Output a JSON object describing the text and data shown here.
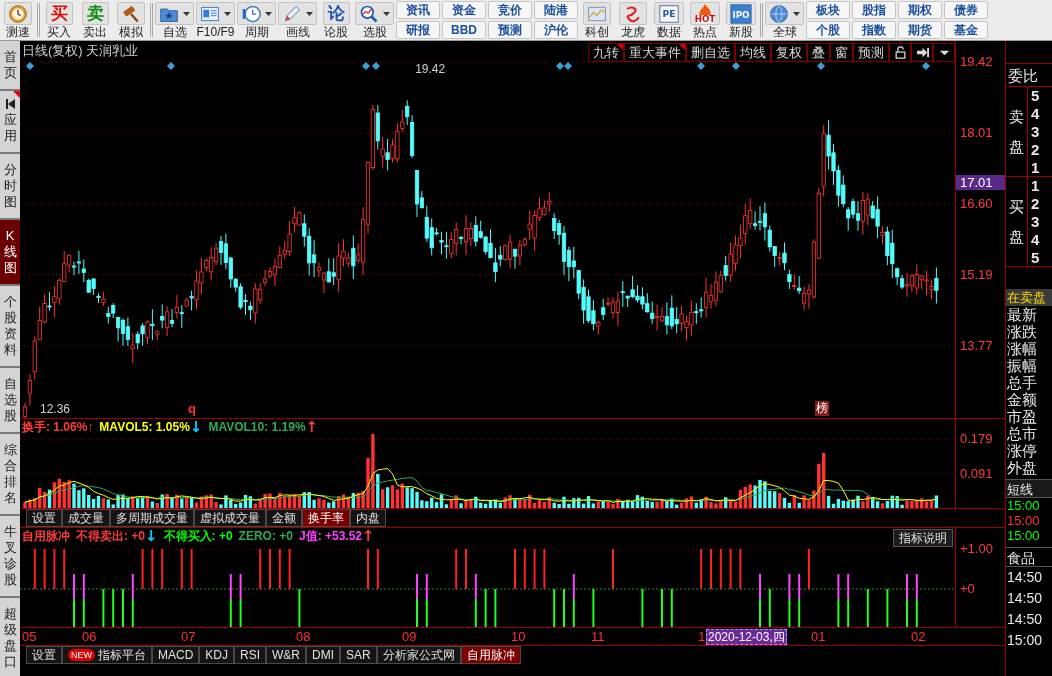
{
  "toolbar": {
    "items": [
      {
        "kind": "tool",
        "label": "测速",
        "dropdown": false
      },
      {
        "kind": "separator"
      },
      {
        "kind": "tool",
        "label": "买入",
        "glyph": "买",
        "color": "#e01010",
        "dropdown": false
      },
      {
        "kind": "tool",
        "label": "卖出",
        "glyph": "卖",
        "color": "#108a10",
        "dropdown": false
      },
      {
        "kind": "tool",
        "label": "模拟",
        "dropdown": false
      },
      {
        "kind": "separator"
      },
      {
        "kind": "tool",
        "label": "自选",
        "dropdown": true
      },
      {
        "kind": "tool",
        "label": "F10/F9",
        "dropdown": true
      },
      {
        "kind": "tool",
        "label": "周期",
        "dropdown": true
      },
      {
        "kind": "tool",
        "label": "画线",
        "dropdown": true
      },
      {
        "kind": "tool",
        "label": "论股",
        "glyph": "论",
        "color": "#1a4fb0",
        "dropdown": false
      },
      {
        "kind": "tool",
        "label": "选股",
        "dropdown": true
      },
      {
        "kind": "pair",
        "buttons": [
          "资讯",
          "研报"
        ]
      },
      {
        "kind": "pair",
        "buttons": [
          "资金",
          "BBD"
        ]
      },
      {
        "kind": "pair",
        "buttons": [
          "竞价",
          "预测"
        ]
      },
      {
        "kind": "pair",
        "buttons": [
          "陆港",
          "沪伦"
        ]
      },
      {
        "kind": "tool",
        "label": "科创",
        "dropdown": false
      },
      {
        "kind": "tool",
        "label": "龙虎",
        "dropdown": false
      },
      {
        "kind": "tool",
        "label": "数据",
        "glyph": "PE",
        "color": "#2a5aa0",
        "dropdown": false
      },
      {
        "kind": "tool",
        "label": "热点",
        "glyph": "HOT",
        "color": "#d01010",
        "dropdown": false
      },
      {
        "kind": "tool",
        "label": "新股",
        "glyph": "IPO",
        "dropdown": false
      },
      {
        "kind": "separator"
      },
      {
        "kind": "tool",
        "label": "全球",
        "dropdown": true
      },
      {
        "kind": "pair",
        "buttons": [
          "板块",
          "个股"
        ]
      },
      {
        "kind": "pair",
        "buttons": [
          "股指",
          "指数"
        ]
      },
      {
        "kind": "pair",
        "buttons": [
          "期权",
          "期货"
        ]
      },
      {
        "kind": "pair",
        "buttons": [
          "债券",
          "基金"
        ]
      }
    ]
  },
  "sidebar": {
    "tabs": [
      {
        "kind": "tab",
        "label": "首页",
        "selected": false,
        "corner_mark": false
      },
      {
        "kind": "icon_tab",
        "label": "应用",
        "selected": false,
        "corner_mark": true
      },
      {
        "kind": "tab",
        "label": "分时图",
        "selected": false,
        "corner_mark": false
      },
      {
        "kind": "tab",
        "label": "K线图",
        "selected": true,
        "corner_mark": false
      },
      {
        "kind": "tab",
        "label": "个股资料",
        "selected": false,
        "corner_mark": false
      },
      {
        "kind": "tab",
        "label": "自选股",
        "selected": false,
        "corner_mark": false
      },
      {
        "kind": "tab",
        "label": "综合排名",
        "selected": false,
        "corner_mark": false
      },
      {
        "kind": "tab",
        "label": "牛叉诊股",
        "selected": false,
        "corner_mark": false
      },
      {
        "kind": "tab",
        "label": "超级盘口",
        "selected": false,
        "corner_mark": false
      }
    ]
  },
  "price_chart": {
    "title": "日线(复权) 天润乳业",
    "tools": [
      {
        "label": "九转",
        "corner_mark": true
      },
      {
        "label": "重大事件",
        "corner_mark": true
      },
      {
        "label": "删自选",
        "corner_mark": false
      },
      {
        "label": "均线",
        "corner_mark": false
      },
      {
        "label": "复权",
        "corner_mark": false
      },
      {
        "label": "叠",
        "corner_mark": false
      },
      {
        "label": "窗",
        "corner_mark": false
      },
      {
        "label": "预测",
        "corner_mark": false
      }
    ],
    "axis_labels": [
      {
        "label": "19.42",
        "highlighted": false
      },
      {
        "label": "18.01",
        "highlighted": false
      },
      {
        "label": "17.01",
        "highlighted": true
      },
      {
        "label": "16.60",
        "highlighted": false
      },
      {
        "label": "15.19",
        "highlighted": false
      },
      {
        "label": "13.77",
        "highlighted": false
      }
    ],
    "high_label": "19.42",
    "low_label": "12.36",
    "signal_mark": "q",
    "badge": "榜"
  },
  "volume_chart": {
    "legend": [
      [
        {
          "text": "换手: 1.06%↑",
          "color": "#ff3c3c"
        }
      ],
      [
        {
          "text": "MAVOL5: 1.05%",
          "color": "#ffff00"
        },
        {
          "text": "↓",
          "color": "#00d0ff"
        }
      ],
      [
        {
          "text": "MAVOL10: 1.19%",
          "color": "#2eaa5a"
        },
        {
          "text": "↑",
          "color": "#ff3c3c"
        }
      ]
    ],
    "axis_labels": [
      "0.179",
      "0.091"
    ],
    "tabs": [
      {
        "label": "设置",
        "selected": false
      },
      {
        "label": "成交量",
        "selected": false
      },
      {
        "label": "多周期成交量",
        "selected": false
      },
      {
        "label": "虚拟成交量",
        "selected": false
      },
      {
        "label": "金额",
        "selected": false
      },
      {
        "label": "换手率",
        "selected": true
      },
      {
        "label": "内盘",
        "selected": false
      }
    ]
  },
  "indicator_chart": {
    "legend": [
      [
        {
          "text": "自用脉冲",
          "color": "#ff3c3c"
        }
      ],
      [
        {
          "text": "不得卖出: +0",
          "color": "#ff3c3c"
        },
        {
          "text": "↓",
          "color": "#00d0ff"
        }
      ],
      [
        {
          "text": "不得买入: +0",
          "color": "#00ff00"
        }
      ],
      [
        {
          "text": "ZERO: +0",
          "color": "#2eaa5a"
        }
      ],
      [
        {
          "text": "J值: +53.52",
          "color": "#ff40ff"
        },
        {
          "text": "↑",
          "color": "#ff3c3c"
        }
      ]
    ],
    "help_button": "指标说明",
    "axis_labels": [
      "+1.00",
      "+0"
    ]
  },
  "x_axis": {
    "months": [
      "05",
      "06",
      "07",
      "08",
      "09",
      "10",
      "11",
      "1",
      "01",
      "02"
    ],
    "cursor_date": "2020-12-03,四"
  },
  "bottom_tabs": [
    {
      "label": "设置",
      "selected": false
    },
    {
      "label": "指标平台",
      "badge": "NEW",
      "selected": false
    },
    {
      "label": "MACD",
      "selected": false
    },
    {
      "label": "KDJ",
      "selected": false
    },
    {
      "label": "RSI",
      "selected": false
    },
    {
      "label": "W&R",
      "selected": false
    },
    {
      "label": "DMI",
      "selected": false
    },
    {
      "label": "SAR",
      "selected": false
    },
    {
      "label": "分析家公式网",
      "selected": false
    },
    {
      "label": "自用脉冲",
      "selected": true
    }
  ],
  "quote_panel": {
    "ratio_label": "委比",
    "sell_label": "卖盘",
    "sell_levels": [
      "5",
      "4",
      "3",
      "2",
      "1"
    ],
    "buy_label": "买盘",
    "buy_levels": [
      "1",
      "2",
      "3",
      "4",
      "5"
    ],
    "notice": "在卖盘",
    "fields": [
      "最新",
      "涨跌",
      "涨幅",
      "振幅",
      "总手",
      "金额",
      "市盈",
      "总市",
      "涨停",
      "外盘"
    ],
    "sprite_title": "短线",
    "sprite_times": [
      {
        "text": "15:00",
        "color": "#00ff00"
      },
      {
        "text": "15:00",
        "color": "#ff3030"
      },
      {
        "text": "15:00",
        "color": "#00ff00"
      }
    ],
    "sector": "食品",
    "times": [
      "14:50",
      "14:50",
      "14:50",
      "15:00"
    ]
  }
}
